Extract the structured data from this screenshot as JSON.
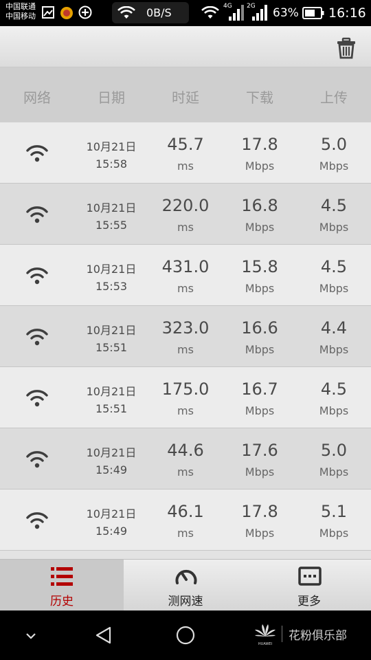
{
  "status_bar": {
    "carrier_1": "中国联通",
    "carrier_2": "中国移动",
    "net_speed": "0B/S",
    "net_4g": "4G",
    "net_2g": "2G",
    "battery_percent": "63%",
    "time": "16:16"
  },
  "table": {
    "headers": [
      "网络",
      "日期",
      "时延",
      "下载",
      "上传"
    ],
    "rows": [
      {
        "network_icon": "wifi-icon",
        "date": "10月21日",
        "time": "15:58",
        "latency": "45.7",
        "latency_unit": "ms",
        "download": "17.8",
        "download_unit": "Mbps",
        "upload": "5.0",
        "upload_unit": "Mbps"
      },
      {
        "network_icon": "wifi-icon",
        "date": "10月21日",
        "time": "15:55",
        "latency": "220.0",
        "latency_unit": "ms",
        "download": "16.8",
        "download_unit": "Mbps",
        "upload": "4.5",
        "upload_unit": "Mbps"
      },
      {
        "network_icon": "wifi-icon",
        "date": "10月21日",
        "time": "15:53",
        "latency": "431.0",
        "latency_unit": "ms",
        "download": "15.8",
        "download_unit": "Mbps",
        "upload": "4.5",
        "upload_unit": "Mbps"
      },
      {
        "network_icon": "wifi-icon",
        "date": "10月21日",
        "time": "15:51",
        "latency": "323.0",
        "latency_unit": "ms",
        "download": "16.6",
        "download_unit": "Mbps",
        "upload": "4.4",
        "upload_unit": "Mbps"
      },
      {
        "network_icon": "wifi-icon",
        "date": "10月21日",
        "time": "15:51",
        "latency": "175.0",
        "latency_unit": "ms",
        "download": "16.7",
        "download_unit": "Mbps",
        "upload": "4.5",
        "upload_unit": "Mbps"
      },
      {
        "network_icon": "wifi-icon",
        "date": "10月21日",
        "time": "15:49",
        "latency": "44.6",
        "latency_unit": "ms",
        "download": "17.6",
        "download_unit": "Mbps",
        "upload": "5.0",
        "upload_unit": "Mbps"
      },
      {
        "network_icon": "wifi-icon",
        "date": "10月21日",
        "time": "15:49",
        "latency": "46.1",
        "latency_unit": "ms",
        "download": "17.8",
        "download_unit": "Mbps",
        "upload": "5.1",
        "upload_unit": "Mbps"
      }
    ]
  },
  "bottom_nav": {
    "items": [
      {
        "label": "历史",
        "icon": "history-list-icon",
        "active": true
      },
      {
        "label": "测网速",
        "icon": "speedometer-icon",
        "active": false
      },
      {
        "label": "更多",
        "icon": "more-dots-icon",
        "active": false
      }
    ]
  },
  "system_nav": {
    "brand_text": "花粉俱乐部",
    "logo_text": "HUAWEI"
  },
  "colors": {
    "active_tab": "#b30000",
    "header_bg": "#cfcfcf",
    "row_light": "#ececec",
    "row_dark": "#dcdcdc"
  }
}
